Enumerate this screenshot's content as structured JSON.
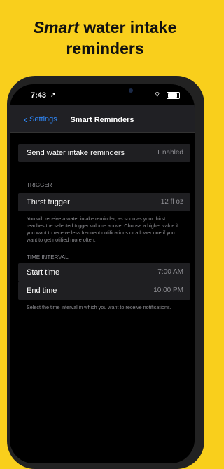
{
  "promo": {
    "headline_emphasis": "Smart",
    "headline_rest": "water intake",
    "headline_line2": "reminders"
  },
  "status_bar": {
    "time": "7:43",
    "location_glyph": "➚",
    "wifi_glyph": "⌔"
  },
  "nav": {
    "back_label": "Settings",
    "title": "Smart Reminders"
  },
  "reminders": {
    "label": "Send water intake reminders",
    "value": "Enabled"
  },
  "trigger_section": {
    "header": "TRIGGER",
    "row_label": "Thirst trigger",
    "row_value": "12 fl oz",
    "footer": "You will receive a water intake reminder, as soon as your thirst reaches the selected trigger volume above. Choose a higher value if you want to receive less frequent notifications or a lower one if you want to get notified more often."
  },
  "interval_section": {
    "header": "TIME INTERVAL",
    "start_label": "Start time",
    "start_value": "7:00 AM",
    "end_label": "End time",
    "end_value": "10:00 PM",
    "footer": "Select the time interval in which you want to receive notifications."
  },
  "colors": {
    "background": "#f9cf1c",
    "accent": "#2f89fb",
    "cell": "#1f1f22"
  },
  "icons": {
    "back": "chevron-left-icon",
    "location": "location-arrow-icon",
    "wifi": "wifi-icon",
    "battery": "battery-icon"
  }
}
